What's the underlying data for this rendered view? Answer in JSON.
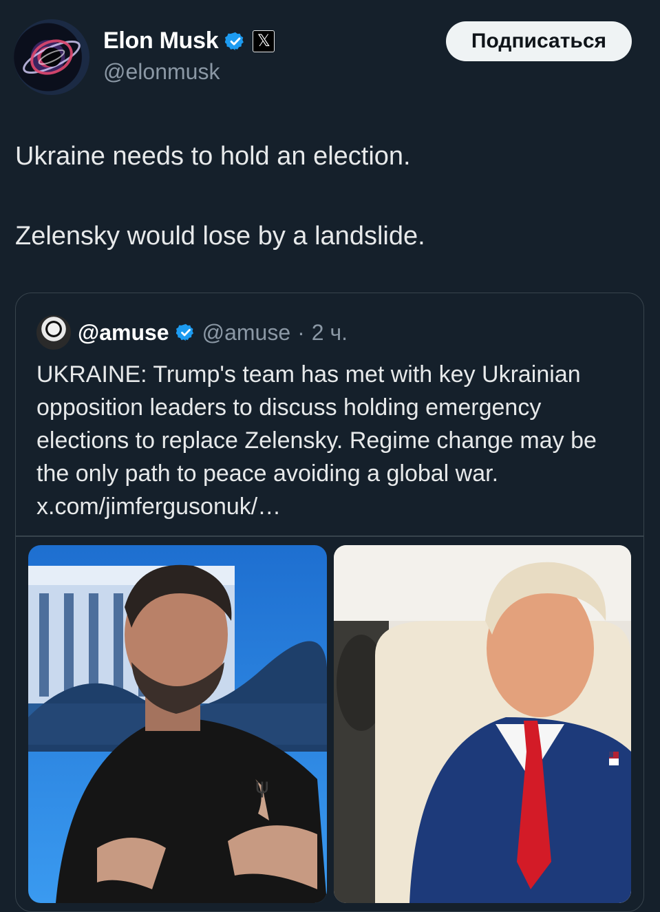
{
  "author": {
    "name": "Elon Musk",
    "handle": "@elonmusk",
    "badge_glyph": "𝕏",
    "avatar_icon": "black-hole-avatar"
  },
  "follow_button": {
    "label": "Подписаться"
  },
  "tweet": {
    "paragraphs": [
      "Ukraine needs to hold an election.",
      "Zelensky would lose by a landslide."
    ]
  },
  "quote": {
    "name": "@amuse",
    "handle": "@amuse",
    "separator": "·",
    "time": "2 ч.",
    "text": "UKRAINE: Trump's team has met with key Ukrainian opposition leaders to discuss holding emergency elections to replace Zelensky. Regime change may be the only path to peace avoiding a global war. x.com/jimfergusonuk/…",
    "avatar_icon": "stormtrooper-avatar"
  },
  "colors": {
    "background": "#15202b",
    "verified_blue": "#1d9bf0",
    "muted_text": "#8b98a5",
    "border": "#38444d"
  }
}
